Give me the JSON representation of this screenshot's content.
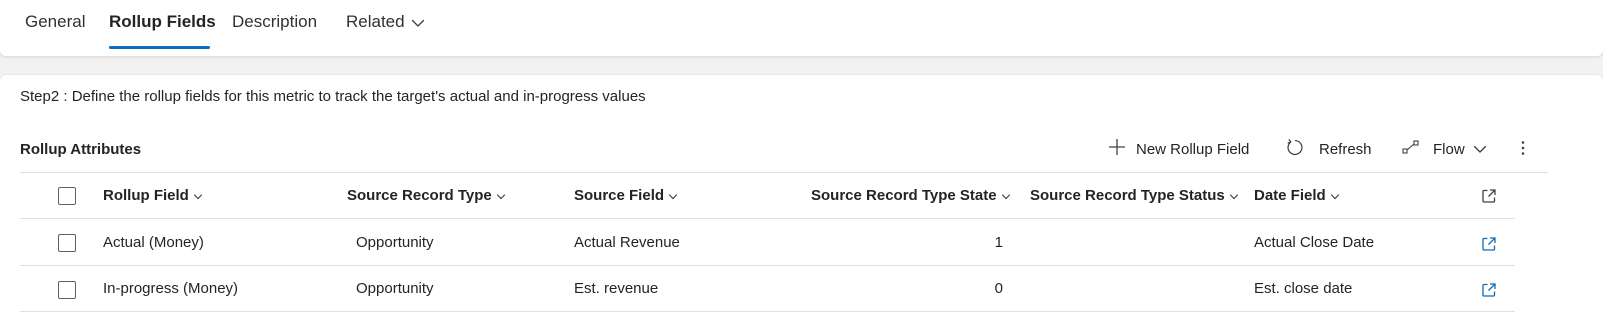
{
  "tabs": [
    {
      "label": "General"
    },
    {
      "label": "Rollup Fields"
    },
    {
      "label": "Description"
    },
    {
      "label": "Related"
    }
  ],
  "card": {
    "step_title": "Step2 : Define the rollup fields for this metric to track the target's actual and in-progress values",
    "section_title": "Rollup Attributes"
  },
  "commands": {
    "new_label": "New Rollup Field",
    "new_icon": "plus-icon",
    "refresh_label": "Refresh",
    "refresh_icon": "refresh-icon",
    "flow_label": "Flow",
    "flow_icon": "flow-icon",
    "more_icon": "more-vertical-icon"
  },
  "grid": {
    "columns": [
      {
        "label": "Rollup Field"
      },
      {
        "label": "Source Record Type"
      },
      {
        "label": "Source Field"
      },
      {
        "label": "Source Record Type State"
      },
      {
        "label": "Source Record Type Status"
      },
      {
        "label": "Date Field"
      }
    ],
    "rows": [
      {
        "rollup_field": "Actual (Money)",
        "source_record_type": "Opportunity",
        "source_field": "Actual Revenue",
        "state": "1",
        "status": "",
        "date_field": "Actual Close Date"
      },
      {
        "rollup_field": "In-progress (Money)",
        "source_record_type": "Opportunity",
        "source_field": "Est. revenue",
        "state": "0",
        "status": "",
        "date_field": "Est. close date"
      }
    ]
  },
  "colors": {
    "accent": "#0f6cbd"
  }
}
